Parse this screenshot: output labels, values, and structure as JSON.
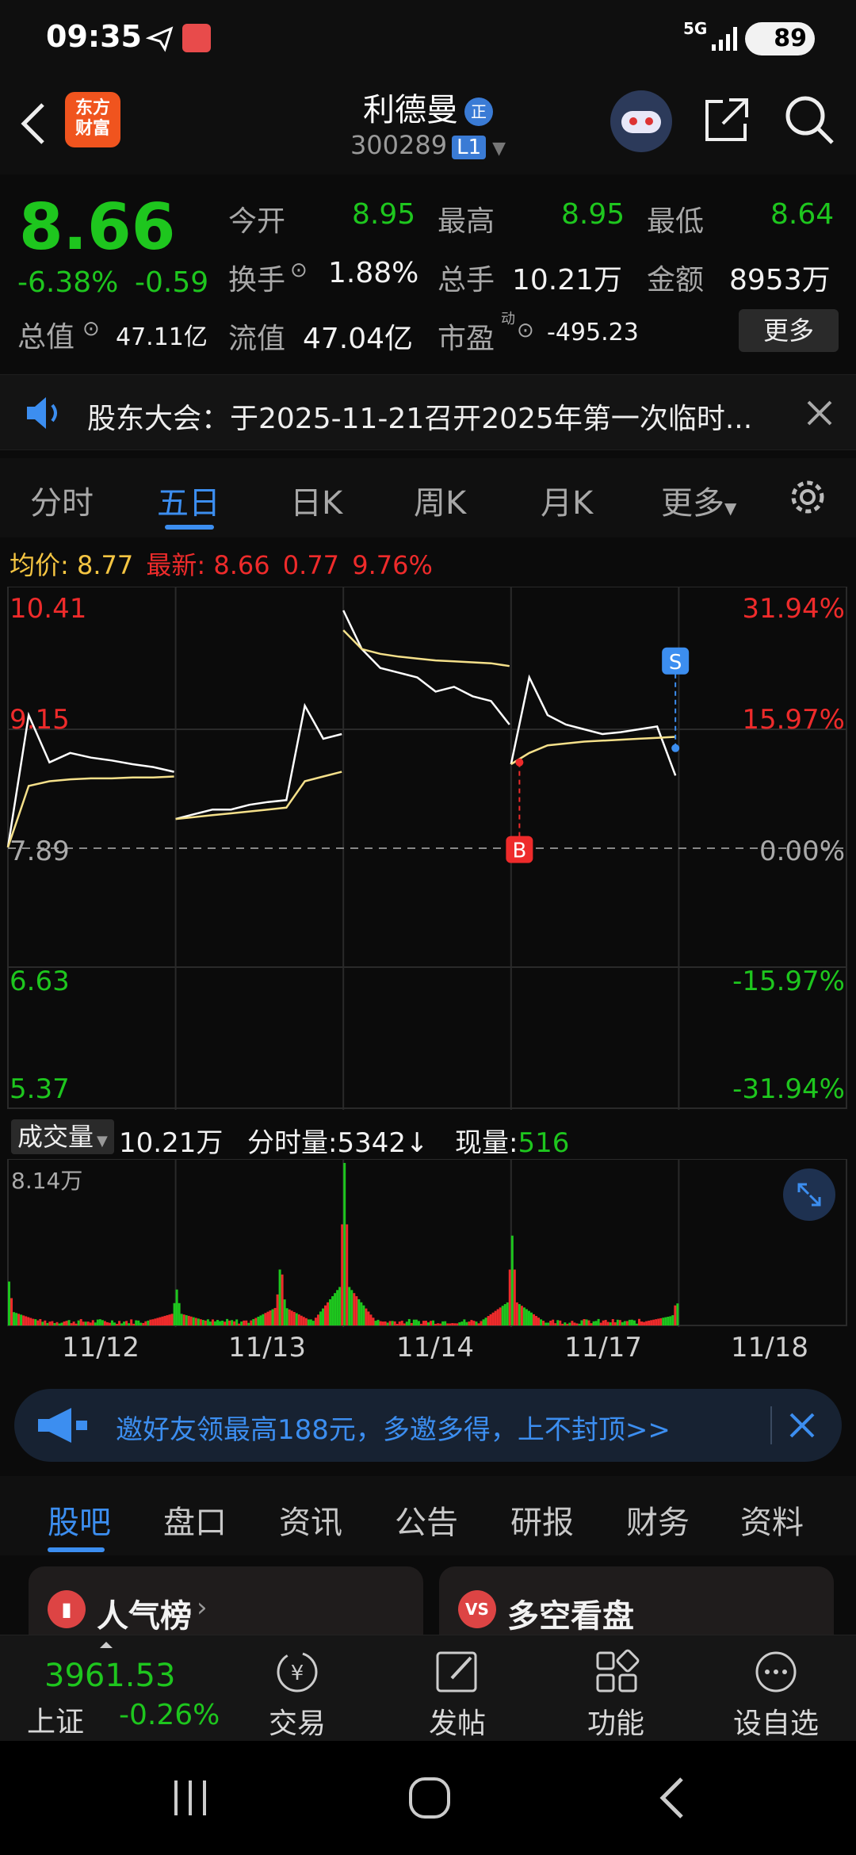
{
  "status_bar": {
    "time": "09:35",
    "network": "5G",
    "battery": "89",
    "icons": [
      "send-icon",
      "app-notification-icon",
      "signal-icon",
      "battery-icon"
    ]
  },
  "header": {
    "stock_name": "利德曼",
    "name_badge": "正",
    "stock_code": "300289",
    "level_badge": "L1",
    "logo_text_top": "东方",
    "logo_text_bottom": "财富",
    "icons": [
      "back-icon",
      "robot-avatar-icon",
      "share-icon",
      "search-icon"
    ]
  },
  "quote": {
    "price": "8.66",
    "change_pct": "-6.38%",
    "change": "-0.59",
    "open_label": "今开",
    "open": "8.95",
    "high_label": "最高",
    "high": "8.95",
    "low_label": "最低",
    "low": "8.64",
    "turnover_label": "换手",
    "turnover": "1.88%",
    "volume_label": "总手",
    "volume": "10.21万",
    "amount_label": "金额",
    "amount": "8953万",
    "mktcap_label": "总值",
    "mktcap": "47.11亿",
    "float_label": "流值",
    "float_cap": "47.04亿",
    "pe_label": "市盈",
    "pe_super": "动",
    "pe": "-495.23",
    "more_button": "更多"
  },
  "notice": {
    "text": "股东大会：于2025-11-21召开2025年第一次临时..."
  },
  "chart_tabs": {
    "items": [
      "分时",
      "五日",
      "日K",
      "周K",
      "月K",
      "更多"
    ],
    "active_index": 1
  },
  "chart_info": {
    "avg_label": "均价:",
    "avg": "8.77",
    "latest_label": "最新:",
    "latest": "8.66",
    "change": "0.77",
    "change_pct": "9.76%"
  },
  "chart_data": {
    "type": "line",
    "y_left_ticks": [
      "10.41",
      "9.15",
      "7.89",
      "6.63",
      "5.37"
    ],
    "y_right_ticks": [
      "31.94%",
      "15.97%",
      "0.00%",
      "-15.97%",
      "-31.94%"
    ],
    "ylim": [
      5.37,
      10.41
    ],
    "reference_price": 7.89,
    "x_days": [
      "11/12",
      "11/13",
      "11/14",
      "11/17",
      "11/18"
    ],
    "series": [
      {
        "name": "",
        "color": "#ffffff",
        "days": [
          [
            7.9,
            9.3,
            8.8,
            8.9,
            8.85,
            8.82,
            8.78,
            8.75,
            8.7
          ],
          [
            8.2,
            8.25,
            8.3,
            8.3,
            8.35,
            8.38,
            8.4,
            9.4,
            9.05,
            9.1
          ],
          [
            10.41,
            10.0,
            9.8,
            9.75,
            9.7,
            9.55,
            9.6,
            9.5,
            9.45,
            9.2
          ],
          [
            8.78,
            9.7,
            9.3,
            9.2,
            9.15,
            9.1,
            9.12,
            9.15,
            9.18,
            8.66
          ]
        ]
      },
      {
        "name": "",
        "color": "#f5e08a",
        "days": [
          [
            7.9,
            8.55,
            8.6,
            8.62,
            8.63,
            8.63,
            8.64,
            8.64,
            8.65
          ],
          [
            8.2,
            8.22,
            8.24,
            8.26,
            8.28,
            8.3,
            8.32,
            8.6,
            8.65,
            8.7
          ],
          [
            10.2,
            10.0,
            9.95,
            9.92,
            9.9,
            9.88,
            9.87,
            9.86,
            9.85,
            9.82
          ],
          [
            8.78,
            8.9,
            8.98,
            9.0,
            9.02,
            9.03,
            9.04,
            9.05,
            9.06,
            9.07
          ]
        ]
      }
    ],
    "markers": [
      {
        "label": "B",
        "day": 3,
        "value": 8.8,
        "color": "#ee2b2b"
      },
      {
        "label": "S",
        "day": 3,
        "value": 8.95,
        "color": "#3c8ef0"
      }
    ],
    "grid": true
  },
  "volume": {
    "selector_label": "成交量",
    "total": "10.21万",
    "period_label": "分时量:",
    "period_value": "5342",
    "arrow": "↓",
    "now_label": "现量:",
    "now_value": "516",
    "max_label": "8.14万",
    "peaks_wan": [
      2.2,
      1.8,
      3.3,
      8.14,
      4.5,
      1.3
    ]
  },
  "invite": {
    "text": "邀好友领最高188元，多邀多得，上不封顶>>"
  },
  "info_tabs": {
    "items": [
      "股吧",
      "盘口",
      "资讯",
      "公告",
      "研报",
      "财务",
      "资料"
    ],
    "active_index": 0
  },
  "cards": [
    {
      "title": "人气榜",
      "icon": "chart-bars-icon"
    },
    {
      "title": "多空看盘",
      "icon": "vs-icon"
    }
  ],
  "toolbar": {
    "index_value": "3961.53",
    "index_name": "上证",
    "index_change": "-0.26%",
    "items": [
      "交易",
      "发帖",
      "功能",
      "设自选"
    ]
  }
}
